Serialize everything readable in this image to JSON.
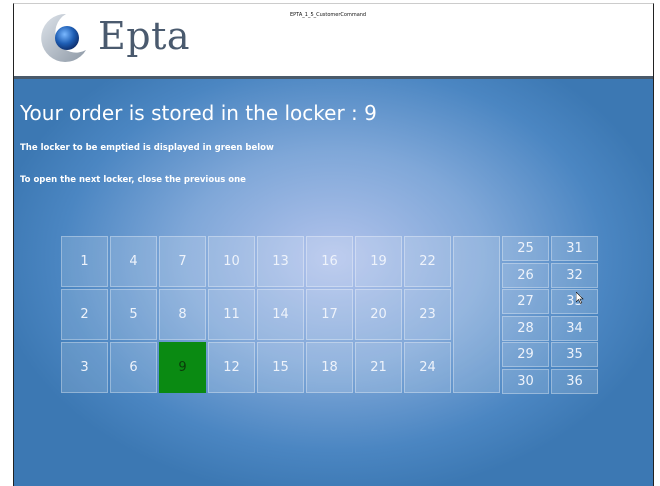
{
  "window_caption": "EPTA_1_5_CustomerCommand",
  "logo": {
    "text": "Epta",
    "icon": "epta-logo-icon"
  },
  "message": {
    "title": "Your order is stored in the locker : 9",
    "line1": "The locker to be emptied is displayed in green below",
    "line2": "To open the next locker, close the previous one"
  },
  "lockers": {
    "active": "9",
    "active_color": "#0a8a12",
    "large": [
      [
        "1",
        "4",
        "7",
        "10",
        "13",
        "16",
        "19",
        "22"
      ],
      [
        "2",
        "5",
        "8",
        "11",
        "14",
        "17",
        "20",
        "23"
      ],
      [
        "3",
        "6",
        "9",
        "12",
        "15",
        "18",
        "21",
        "24"
      ]
    ],
    "small": [
      [
        "25",
        "31"
      ],
      [
        "26",
        "32"
      ],
      [
        "27",
        "33"
      ],
      [
        "28",
        "34"
      ],
      [
        "29",
        "35"
      ],
      [
        "30",
        "36"
      ]
    ]
  }
}
